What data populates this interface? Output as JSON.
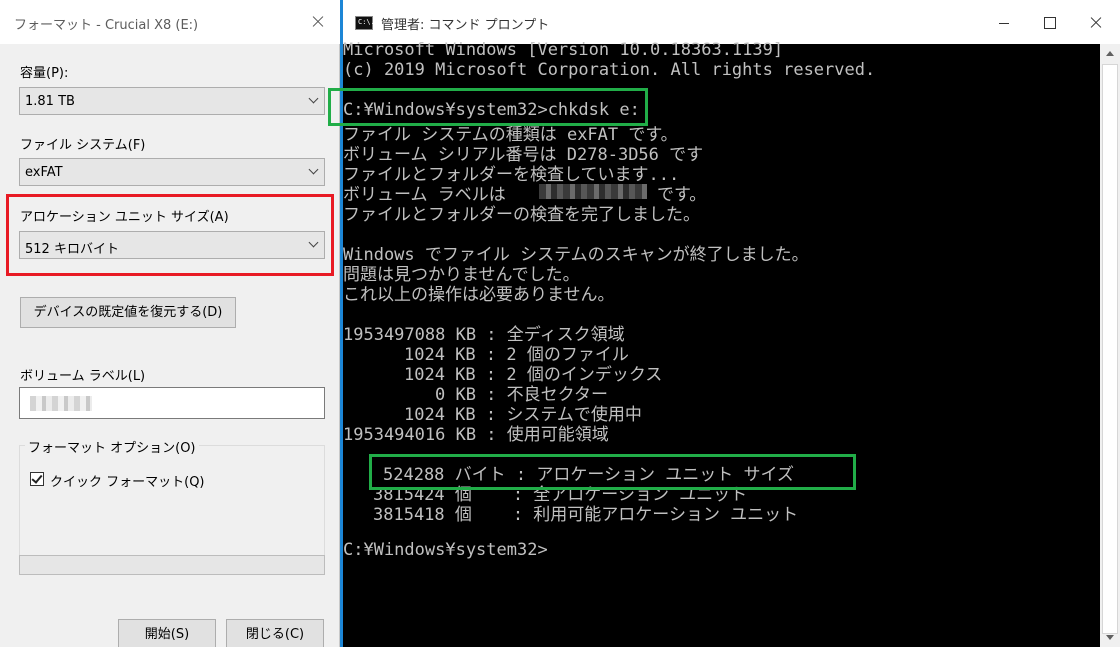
{
  "format_dialog": {
    "title": "フォーマット - Crucial X8 (E:)",
    "capacity_label": "容量(P):",
    "capacity_value": "1.81 TB",
    "filesystem_label": "ファイル システム(F)",
    "filesystem_value": "exFAT",
    "alloc_label": "アロケーション ユニット サイズ(A)",
    "alloc_value": "512 キロバイト",
    "restore_defaults_button": "デバイスの既定値を復元する(D)",
    "volume_label_label": "ボリューム ラベル(L)",
    "volume_label_value": "",
    "format_options_label": "フォーマット オプション(O)",
    "quick_format_label": "クイック フォーマット(Q)",
    "quick_format_checked": true,
    "progress": 0,
    "start_button": "開始(S)",
    "close_button": "閉じる(C)"
  },
  "cmd_window": {
    "title": "管理者: コマンド プロンプト",
    "icon_text": "C:\\.",
    "lines": {
      "l1": "Microsoft Windows [Version 10.0.18363.1139]",
      "l2": "(c) 2019 Microsoft Corporation. All rights reserved.",
      "l3": "C:¥Windows¥system32>chkdsk e:",
      "l4": "ファイル システムの種類は exFAT です。",
      "l5": "ボリューム シリアル番号は D278-3D56 です",
      "l6": "ファイルとフォルダーを検査しています...",
      "l7a": "ボリューム ラベルは",
      "l7b": "です。",
      "l8": "ファイルとフォルダーの検査を完了しました。",
      "l9": "Windows でファイル システムのスキャンが終了しました。",
      "l10": "問題は見つかりませんでした。",
      "l11": "これ以上の操作は必要ありません。",
      "l12": "1953497088 KB : 全ディスク領域",
      "l13": "1024 KB : 2 個のファイル",
      "l14": "1024 KB : 2 個のインデックス",
      "l15": "0 KB : 不良セクター",
      "l16": "1024 KB : システムで使用中",
      "l17": "1953494016 KB : 使用可能領域",
      "l18": "524288 バイト : アロケーション ユニット サイズ",
      "l19": "3815424 個    : 全アロケーション ユニット",
      "l20": "3815418 個    : 利用可能アロケーション ユニット",
      "l21": "C:¥Windows¥system32>"
    }
  },
  "highlight_colors": {
    "red": "#e81a24",
    "green": "#21ad48"
  }
}
